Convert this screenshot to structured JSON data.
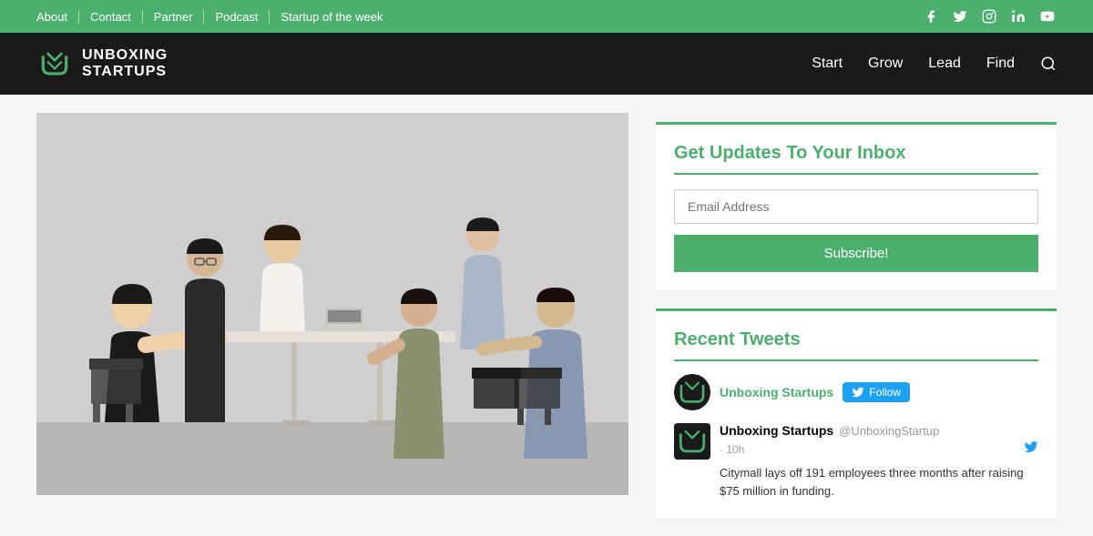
{
  "topbar": {
    "links": [
      {
        "label": "About",
        "href": "#"
      },
      {
        "label": "Contact",
        "href": "#"
      },
      {
        "label": "Partner",
        "href": "#"
      },
      {
        "label": "Podcast",
        "href": "#"
      },
      {
        "label": "Startup of the week",
        "href": "#"
      }
    ],
    "social": [
      {
        "name": "facebook-icon",
        "glyph": "f"
      },
      {
        "name": "twitter-icon",
        "glyph": "t"
      },
      {
        "name": "instagram-icon",
        "glyph": "i"
      },
      {
        "name": "linkedin-icon",
        "glyph": "in"
      },
      {
        "name": "youtube-icon",
        "glyph": "▶"
      }
    ]
  },
  "header": {
    "brand_line1": "UNBOXING",
    "brand_line2": "STARTUPS",
    "nav": [
      {
        "label": "Start",
        "href": "#"
      },
      {
        "label": "Grow",
        "href": "#"
      },
      {
        "label": "Lead",
        "href": "#"
      },
      {
        "label": "Find",
        "href": "#"
      }
    ]
  },
  "sidebar": {
    "newsletter": {
      "title": "Get Updates To Your Inbox",
      "email_placeholder": "Email Address",
      "subscribe_label": "Subscribe!"
    },
    "recent_tweets": {
      "title": "Recent Tweets",
      "account_name": "Unboxing Startups",
      "follow_label": "Follow",
      "tweet": {
        "username": "Unboxing Startups",
        "handle": "@UnboxingStartup",
        "time": "· 10h",
        "text": "Citymall lays off 191 employees three months after raising $75 million in funding."
      }
    }
  }
}
